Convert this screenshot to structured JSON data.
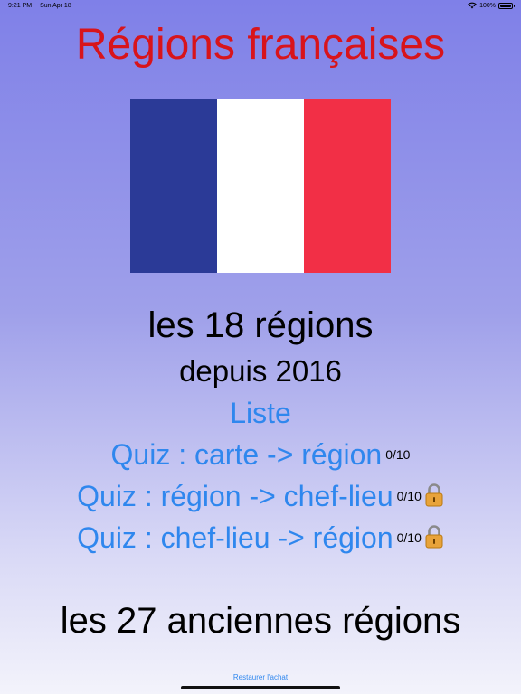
{
  "status_bar": {
    "time": "9:21 PM",
    "date": "Sun Apr 18",
    "battery_text": "100%",
    "battery_level": 1.0,
    "icons": [
      "wifi-icon",
      "battery-icon"
    ]
  },
  "title": "Régions françaises",
  "flag": {
    "colors": [
      "#2b3a97",
      "#ffffff",
      "#f22f46"
    ]
  },
  "section_current": {
    "heading": "les 18 régions",
    "subheading": "depuis 2016",
    "list_label": "Liste",
    "quizzes": [
      {
        "label": "Quiz : carte -> région",
        "score": "0/10",
        "locked": false
      },
      {
        "label": "Quiz : région -> chef-lieu",
        "score": "0/10",
        "locked": true
      },
      {
        "label": "Quiz : chef-lieu -> région",
        "score": "0/10",
        "locked": true
      }
    ]
  },
  "section_old": {
    "heading": "les 27 anciennes régions"
  },
  "restore_label": "Restaurer l'achat",
  "colors": {
    "title": "#d8141b",
    "link": "#2f87ee",
    "lock_body": "#e8a33a"
  }
}
